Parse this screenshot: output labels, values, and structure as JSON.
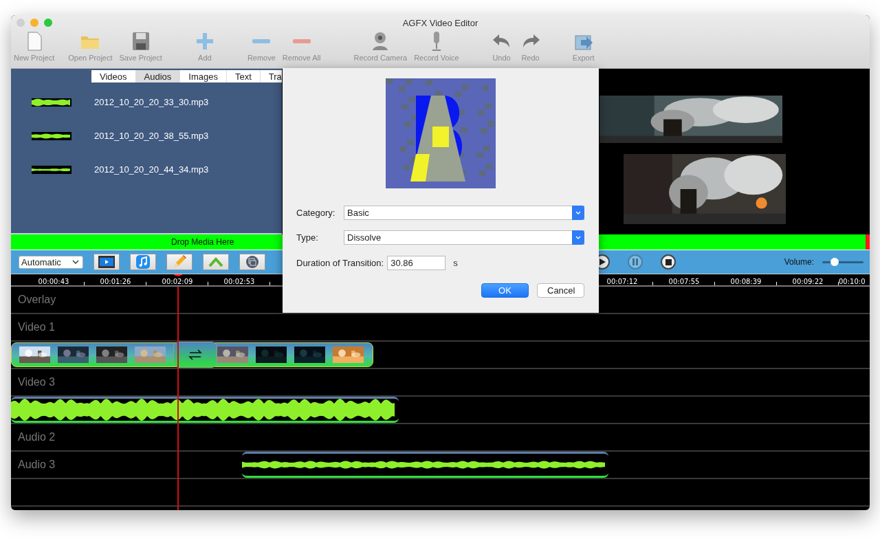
{
  "window": {
    "title": "AGFX Video Editor"
  },
  "toolbar": [
    {
      "label": "New Project",
      "kind": "new"
    },
    {
      "label": "Open Project",
      "kind": "open"
    },
    {
      "label": "Save Project",
      "kind": "save"
    },
    {
      "label": "Add",
      "kind": "add"
    },
    {
      "label": "Remove",
      "kind": "remove"
    },
    {
      "label": "Remove All",
      "kind": "remove_all"
    },
    {
      "label": "Record Camera",
      "kind": "camera"
    },
    {
      "label": "Record Voice",
      "kind": "voice"
    },
    {
      "label": "Undo",
      "kind": "undo"
    },
    {
      "label": "Redo",
      "kind": "redo"
    },
    {
      "label": "Export",
      "kind": "export"
    }
  ],
  "media_tabs": [
    {
      "label": "Videos",
      "selected": false
    },
    {
      "label": "Audios",
      "selected": true
    },
    {
      "label": "Images",
      "selected": false
    },
    {
      "label": "Text",
      "selected": false
    },
    {
      "label": "Tra",
      "selected": false
    }
  ],
  "media_items": [
    {
      "name": "2012_10_20_20_33_30.mp3"
    },
    {
      "name": "2012_10_20_20_38_55.mp3"
    },
    {
      "name": "2012_10_20_20_44_34.mp3"
    }
  ],
  "drop_zone": {
    "label": "Drop Media Here"
  },
  "controls": {
    "mode": "Automatic",
    "tools": [
      {
        "kind": "film"
      },
      {
        "kind": "music"
      },
      {
        "kind": "pencil"
      },
      {
        "kind": "arrows"
      },
      {
        "kind": "layers"
      }
    ],
    "volume": {
      "label": "Volume:",
      "level": 0.3
    }
  },
  "playback": [
    {
      "kind": "play"
    },
    {
      "kind": "pause",
      "disabled": true
    },
    {
      "kind": "stop",
      "disabled": false
    }
  ],
  "ruler": {
    "left": [
      "00:00:43",
      "00:01:26",
      "00:02:09",
      "00:02:53"
    ],
    "right": [
      "00:07:12",
      "00:07:55",
      "00:08:39",
      "00:09:22",
      "00:10:0"
    ]
  },
  "lanes": [
    {
      "label": "Overlay"
    },
    {
      "label": "Video 1"
    },
    {
      "clip": {
        "kind": "video"
      }
    },
    {
      "label": "Video 3"
    },
    {
      "clip": {
        "kind": "audio_loud"
      }
    },
    {
      "label": "Audio 2"
    },
    {
      "label": "Audio 3",
      "clip": {
        "kind": "audio_quiet"
      }
    }
  ],
  "dialog": {
    "category": {
      "label": "Category:",
      "value": "Basic"
    },
    "type": {
      "label": "Type:",
      "value": "Dissolve"
    },
    "duration": {
      "label": "Duration of Transition:",
      "value": "30.86",
      "unit": "s"
    },
    "buttons": [
      {
        "label": "OK",
        "kind": "primary"
      },
      {
        "label": "Cancel",
        "kind": "secondary"
      }
    ]
  }
}
